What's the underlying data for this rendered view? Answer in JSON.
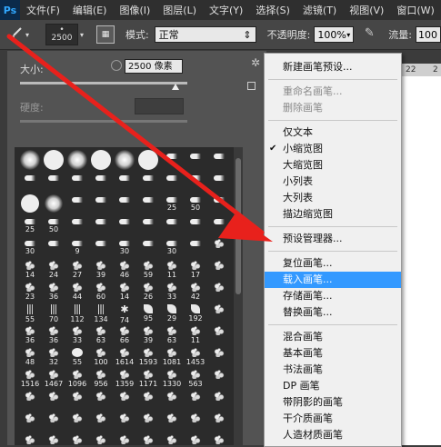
{
  "app": {
    "logo": "Ps"
  },
  "menubar": {
    "items": [
      "文件(F)",
      "编辑(E)",
      "图像(I)",
      "图层(L)",
      "文字(Y)",
      "选择(S)",
      "滤镜(T)",
      "视图(V)",
      "窗口(W)"
    ]
  },
  "options": {
    "brush_size": "2500",
    "mode_label": "模式:",
    "mode_value": "正常",
    "opacity_label": "不透明度:",
    "opacity_value": "100%",
    "flow_label": "流量:",
    "flow_value": "100"
  },
  "ruler": {
    "labels": [
      "22",
      "2"
    ]
  },
  "brush_panel": {
    "size_label": "大小:",
    "size_value": "2500 像素",
    "size_slider_fraction": 0.93,
    "hardness_label": "硬度:",
    "grid": [
      [
        {
          "s": "soft"
        },
        {
          "s": "round"
        },
        {
          "s": "soft"
        },
        {
          "s": "round"
        },
        {
          "s": "soft"
        },
        {
          "s": "round"
        },
        {
          "s": "tip"
        },
        {
          "s": "tip"
        },
        {
          "s": "tip"
        }
      ],
      [
        {
          "s": "tip"
        },
        {
          "s": "tip"
        },
        {
          "s": "tip"
        },
        {
          "s": "tip"
        },
        {
          "s": "tip"
        },
        {
          "s": "tip"
        },
        {
          "s": "tip"
        },
        {
          "s": "tip"
        },
        {
          "s": "tip"
        }
      ],
      [
        {
          "s": "round"
        },
        {
          "s": "soft"
        },
        {
          "s": "tip"
        },
        {
          "s": "tip"
        },
        {
          "s": "tip"
        },
        {
          "s": "tip"
        },
        {
          "s": "tip",
          "n": "25"
        },
        {
          "s": "tip",
          "n": "50"
        },
        {
          "s": "tip"
        }
      ],
      [
        {
          "s": "tip",
          "n": "25"
        },
        {
          "s": "tip",
          "n": "50"
        },
        {
          "s": "tip"
        },
        {
          "s": "tip"
        },
        {
          "s": "tip"
        },
        {
          "s": "tip"
        },
        {
          "s": "tip"
        },
        {
          "s": "tip"
        },
        {
          "s": "tip"
        }
      ],
      [
        {
          "s": "tip",
          "n": "30"
        },
        {
          "s": "tip"
        },
        {
          "s": "tip",
          "n": "9"
        },
        {
          "s": "tip"
        },
        {
          "s": "tip",
          "n": "30"
        },
        {
          "s": "tip"
        },
        {
          "s": "tip",
          "n": "30"
        },
        {
          "s": "tip"
        },
        {
          "s": "splat"
        }
      ],
      [
        {
          "s": "splat",
          "n": "14"
        },
        {
          "s": "splat",
          "n": "24"
        },
        {
          "s": "splat",
          "n": "27"
        },
        {
          "s": "splat",
          "n": "39"
        },
        {
          "s": "splat",
          "n": "46"
        },
        {
          "s": "splat",
          "n": "59"
        },
        {
          "s": "splat",
          "n": "11"
        },
        {
          "s": "splat",
          "n": "17"
        },
        {
          "s": "splat"
        }
      ],
      [
        {
          "s": "splat",
          "n": "23"
        },
        {
          "s": "splat",
          "n": "36"
        },
        {
          "s": "splat",
          "n": "44"
        },
        {
          "s": "splat",
          "n": "60"
        },
        {
          "s": "splat",
          "n": "14"
        },
        {
          "s": "splat",
          "n": "26"
        },
        {
          "s": "splat",
          "n": "33"
        },
        {
          "s": "splat",
          "n": "42"
        },
        {
          "s": "splat"
        }
      ],
      [
        {
          "s": "grass",
          "n": "55"
        },
        {
          "s": "grass",
          "n": "70"
        },
        {
          "s": "grass",
          "n": "112"
        },
        {
          "s": "grass",
          "n": "134"
        },
        {
          "s": "star",
          "n": "74"
        },
        {
          "s": "leaf",
          "n": "95"
        },
        {
          "s": "leaf",
          "n": "29"
        },
        {
          "s": "leaf",
          "n": "192"
        },
        {
          "s": "splat"
        }
      ],
      [
        {
          "s": "splat",
          "n": "36"
        },
        {
          "s": "splat",
          "n": "36"
        },
        {
          "s": "splat",
          "n": "33"
        },
        {
          "s": "splat",
          "n": "63"
        },
        {
          "s": "splat",
          "n": "66"
        },
        {
          "s": "splat",
          "n": "39"
        },
        {
          "s": "splat",
          "n": "63"
        },
        {
          "s": "splat",
          "n": "11"
        },
        {
          "s": "splat"
        }
      ],
      [
        {
          "s": "splat",
          "n": "48"
        },
        {
          "s": "splat",
          "n": "32"
        },
        {
          "s": "round",
          "n": "55"
        },
        {
          "s": "splat",
          "n": "100"
        },
        {
          "s": "splat",
          "n": "1614"
        },
        {
          "s": "splat",
          "n": "1593"
        },
        {
          "s": "splat",
          "n": "1081"
        },
        {
          "s": "splat",
          "n": "1453"
        },
        {
          "s": "splat"
        }
      ],
      [
        {
          "s": "splat",
          "n": "1516"
        },
        {
          "s": "splat",
          "n": "1467"
        },
        {
          "s": "splat",
          "n": "1096"
        },
        {
          "s": "splat",
          "n": "956"
        },
        {
          "s": "splat",
          "n": "1359"
        },
        {
          "s": "splat",
          "n": "1171"
        },
        {
          "s": "splat",
          "n": "1330"
        },
        {
          "s": "splat",
          "n": "563"
        },
        {
          "s": "splat"
        }
      ],
      [
        {
          "s": "splat"
        },
        {
          "s": "splat"
        },
        {
          "s": "splat"
        },
        {
          "s": "splat"
        },
        {
          "s": "splat"
        },
        {
          "s": "splat"
        },
        {
          "s": "splat"
        },
        {
          "s": "splat"
        },
        {
          "s": "splat"
        }
      ],
      [
        {
          "s": "splat"
        },
        {
          "s": "splat"
        },
        {
          "s": "splat"
        },
        {
          "s": "splat"
        },
        {
          "s": "splat"
        },
        {
          "s": "splat"
        },
        {
          "s": "splat"
        },
        {
          "s": "splat"
        },
        {
          "s": "splat"
        }
      ],
      [
        {
          "s": "splat"
        },
        {
          "s": "splat"
        },
        {
          "s": "splat"
        },
        {
          "s": "splat"
        },
        {
          "s": "splat"
        },
        {
          "s": "splat"
        },
        {
          "s": "splat"
        },
        {
          "s": "splat"
        },
        {
          "s": "splat"
        }
      ]
    ]
  },
  "context_menu": {
    "groups": [
      [
        {
          "label": "新建画笔预设..."
        }
      ],
      [
        {
          "label": "重命名画笔...",
          "disabled": true
        },
        {
          "label": "删除画笔",
          "disabled": true
        }
      ],
      [
        {
          "label": "仅文本"
        },
        {
          "label": "小缩览图",
          "checked": true
        },
        {
          "label": "大缩览图"
        },
        {
          "label": "小列表"
        },
        {
          "label": "大列表"
        },
        {
          "label": "描边缩览图"
        }
      ],
      [
        {
          "label": "预设管理器..."
        }
      ],
      [
        {
          "label": "复位画笔..."
        },
        {
          "label": "载入画笔...",
          "highlight": true
        },
        {
          "label": "存储画笔..."
        },
        {
          "label": "替换画笔..."
        }
      ],
      [
        {
          "label": "混合画笔"
        },
        {
          "label": "基本画笔"
        },
        {
          "label": "书法画笔"
        },
        {
          "label": "DP 画笔"
        },
        {
          "label": "带阴影的画笔"
        },
        {
          "label": "干介质画笔"
        },
        {
          "label": "人造材质画笔"
        }
      ]
    ]
  },
  "annotation": {
    "arrow_color": "#e8211c"
  }
}
